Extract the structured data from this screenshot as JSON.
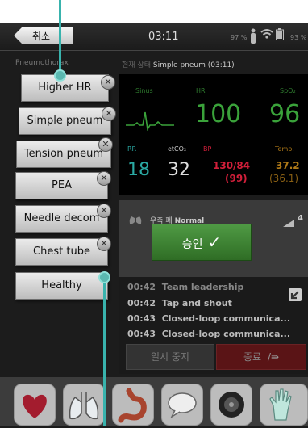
{
  "status_bar": {
    "back_label": "취소",
    "time": "03:11",
    "battery_left": "97 %",
    "battery_right": "93 %"
  },
  "header": {
    "scenario_label": "Pneumothorax",
    "state_prefix": "현재 상태",
    "state_value": "Simple pneum (03:11)"
  },
  "monitor": {
    "rhythm_label": "Sinus",
    "hr_label": "HR",
    "hr_value": "100",
    "spo2_label": "SpO₂",
    "spo2_value": "96",
    "rr_label": "RR",
    "rr_value": "18",
    "etco2_label": "etCO₂",
    "etco2_value": "32",
    "bp_label": "BP",
    "bp_value": "130/84",
    "bp_map": "(99)",
    "temp_label": "Temp.",
    "temp_value": "37.2",
    "temp_sub": "(36.1)",
    "colors": {
      "green": "#3aa23a",
      "cyan": "#2aa9a3",
      "red": "#d11f3a",
      "amber": "#b07a18"
    }
  },
  "panel": {
    "lung_text_prefix": "우측 폐",
    "lung_text": "Normal",
    "signal": "4",
    "approve_label": "승인"
  },
  "scenarios": [
    {
      "label": "Higher HR"
    },
    {
      "label": "Simple pneum"
    },
    {
      "label": "Tension pneum"
    },
    {
      "label": "PEA"
    },
    {
      "label": "Needle decom"
    },
    {
      "label": "Chest tube"
    },
    {
      "label": "Healthy"
    }
  ],
  "log": [
    {
      "time": "00:42",
      "text": "Team leadership"
    },
    {
      "time": "00:42",
      "text": "Tap and shout"
    },
    {
      "time": "00:43",
      "text": "Closed-loop communica..."
    },
    {
      "time": "00:43",
      "text": "Closed-loop communica..."
    }
  ],
  "buttons": {
    "pause_label": "일시 중지",
    "end_label": "종료"
  },
  "toolbar": [
    "heart-icon",
    "lungs-icon",
    "stomach-icon",
    "speech-bubble-icon",
    "speaker-icon",
    "glove-icon"
  ]
}
